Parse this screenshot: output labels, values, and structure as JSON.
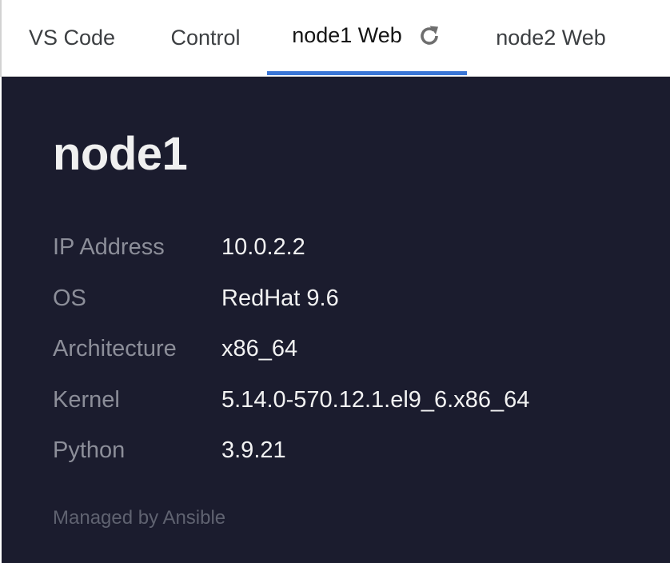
{
  "tabs": [
    {
      "label": "VS Code"
    },
    {
      "label": "Control"
    },
    {
      "label": "node1 Web",
      "active": true,
      "icon": "reload-icon"
    },
    {
      "label": "node2 Web"
    }
  ],
  "host": {
    "name": "node1"
  },
  "facts": [
    {
      "label": "IP Address",
      "value": "10.0.2.2"
    },
    {
      "label": "OS",
      "value": "RedHat 9.6"
    },
    {
      "label": "Architecture",
      "value": "x86_64"
    },
    {
      "label": "Kernel",
      "value": "5.14.0-570.12.1.el9_6.x86_64"
    },
    {
      "label": "Python",
      "value": "3.9.21"
    }
  ],
  "footer": {
    "text": "Managed by Ansible"
  },
  "colors": {
    "active_tab_underline": "#3a76d6",
    "panel_background": "#1b1c2e"
  }
}
